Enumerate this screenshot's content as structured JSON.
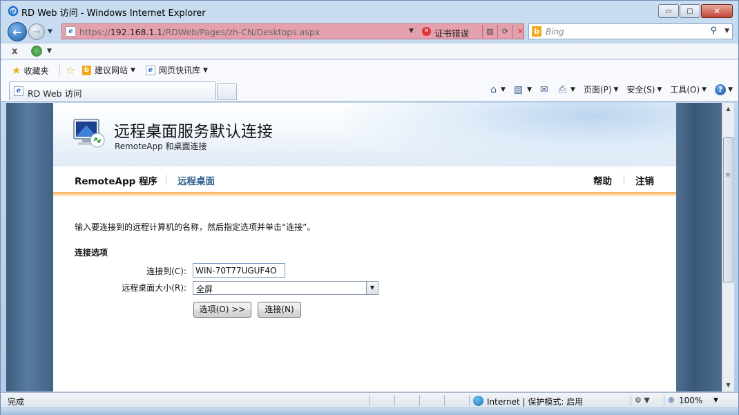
{
  "window": {
    "title": "RD Web 访问 - Windows Internet Explorer",
    "controls": {
      "minimize": "▭",
      "maximize": "□",
      "close": "✕"
    }
  },
  "navigation": {
    "back_icon": "←",
    "forward_icon": "→",
    "address_scheme": "https://",
    "address_host": "192.168.1.1",
    "address_path": "/RDWeb/Pages/zh-CN/Desktops.aspx",
    "cert_error": "证书错误",
    "search_placeholder": "Bing"
  },
  "favorites_bar": {
    "favorites": "收藏夹",
    "suggested_sites": "建议网站",
    "web_slice": "网页快讯库"
  },
  "tabs": [
    {
      "label": "RD Web 访问"
    }
  ],
  "command_bar": {
    "page": "页面(P)",
    "safety": "安全(S)",
    "tools": "工具(O)"
  },
  "page": {
    "title": "远程桌面服务默认连接",
    "subtitle": "RemoteApp 和桌面连接",
    "nav": {
      "remoteapp": "RemoteApp 程序",
      "desktops": "远程桌面",
      "help": "帮助",
      "logout": "注销"
    },
    "instruction": "输入要连接到的远程计算机的名称，然后指定选项并单击“连接”。",
    "section_label": "连接选项",
    "connect_to_label": "连接到(C):",
    "connect_to_value": "WIN-70T77UGUF4O",
    "size_label": "远程桌面大小(R):",
    "size_value": "全屏",
    "options_button": "选项(O) >>",
    "connect_button": "连接(N)"
  },
  "status_bar": {
    "status": "完成",
    "zone": "Internet | 保护模式: 启用",
    "zoom": "100%"
  },
  "colors": {
    "address_error_bg": "#e5a0ad",
    "accent_link": "#2f5e8d",
    "orange_bar": "#f7b054"
  },
  "icons": [
    "ie-icon",
    "back-arrow-icon",
    "forward-arrow-icon",
    "certificate-error-icon",
    "compatibility-icon",
    "refresh-icon",
    "stop-icon",
    "bing-icon",
    "search-icon",
    "favorites-star-icon",
    "add-favorites-icon",
    "home-icon",
    "rss-icon",
    "mail-icon",
    "print-icon",
    "help-icon",
    "remote-desktop-monitor-icon",
    "internet-zone-globe-icon",
    "zoom-icon"
  ]
}
